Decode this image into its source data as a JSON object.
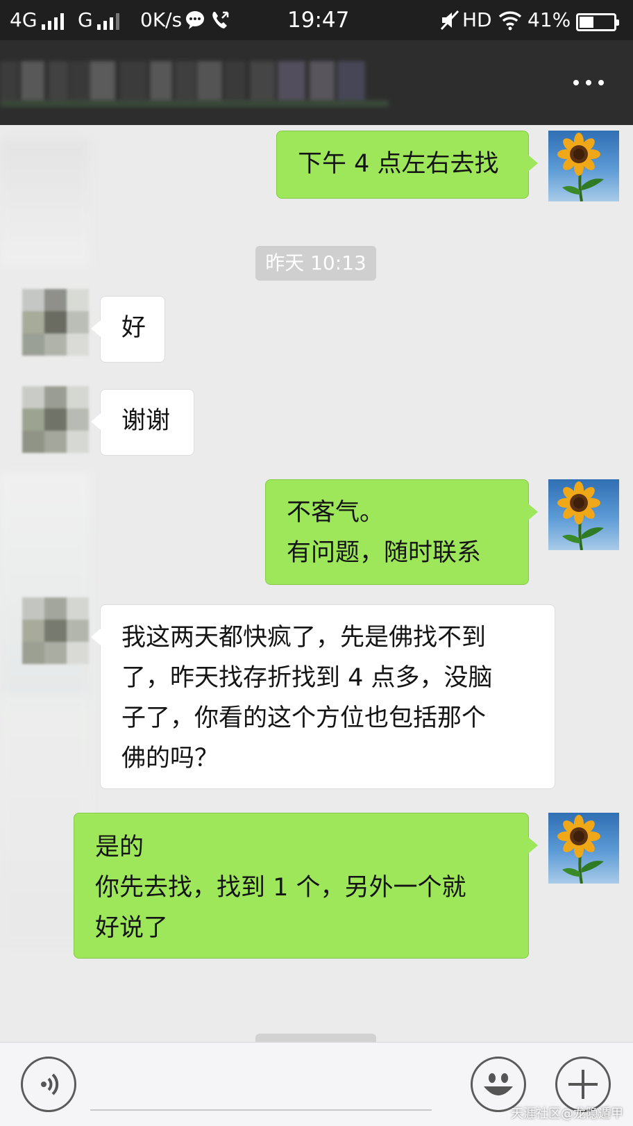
{
  "status_bar": {
    "network1": "4G",
    "network2": "G",
    "speed": "0K/s",
    "time": "19:47",
    "hd": "HD",
    "battery": "41%",
    "battery_level": 0.41
  },
  "header": {
    "more_icon": "more-horizontal-icon"
  },
  "messages": [
    {
      "side": "right",
      "text": "下午 4 点左右去找"
    },
    {
      "side": "time",
      "text": "昨天 10:13"
    },
    {
      "side": "left",
      "text": "好"
    },
    {
      "side": "left",
      "text": "谢谢"
    },
    {
      "side": "right",
      "text": "不客气。\n有问题，随时联系"
    },
    {
      "side": "left",
      "text": "我这两天都快疯了，先是佛找不到\n了，昨天找存折找到 4 点多，没脑\n子了，你看的这个方位也包括那个\n佛的吗？"
    },
    {
      "side": "right",
      "text": "是的\n你先去找，找到 1 个，另外一个就\n好说了"
    }
  ],
  "input_bar": {
    "voice_icon": "voice-icon",
    "emoji_icon": "emoji-icon",
    "plus_icon": "plus-icon"
  },
  "watermark": "天涯社区@龙隐遁甲",
  "colors": {
    "bubble_right": "#9fe75a",
    "bubble_left": "#ffffff",
    "chat_bg": "#ebebeb",
    "header_bg": "#2d2d2d"
  }
}
